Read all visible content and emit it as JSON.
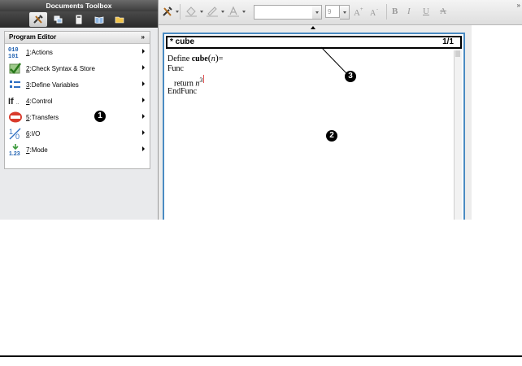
{
  "toolbox": {
    "title": "Documents Toolbox",
    "tabs": [
      {
        "icon": "tools-icon",
        "active": true
      },
      {
        "icon": "page-sorter-icon",
        "active": false
      },
      {
        "icon": "utilities-icon",
        "active": false
      },
      {
        "icon": "content-explorer-icon",
        "active": false
      },
      {
        "icon": "folder-icon",
        "active": false
      }
    ]
  },
  "program_editor": {
    "header": "Program Editor",
    "collapse_glyph": "»",
    "items": [
      {
        "number": "1",
        "label": "Actions",
        "icon": "actions-icon"
      },
      {
        "number": "2",
        "label": "Check Syntax & Store",
        "icon": "check-syntax-icon"
      },
      {
        "number": "3",
        "label": "Define Variables",
        "icon": "define-variables-icon"
      },
      {
        "number": "4",
        "label": "Control",
        "icon": "control-icon"
      },
      {
        "number": "5",
        "label": "Transfers",
        "icon": "transfers-icon"
      },
      {
        "number": "6",
        "label": "I/O",
        "icon": "io-icon"
      },
      {
        "number": "7",
        "label": "Mode",
        "icon": "mode-icon"
      }
    ]
  },
  "format_toolbar": {
    "font_value": "",
    "font_size": "9",
    "bold": "B",
    "italic": "I",
    "underline": "U",
    "strike": "A",
    "expand_glyph": "»"
  },
  "editor": {
    "title": "* cube",
    "page": "1/1",
    "define_keyword": "Define ",
    "function_name": "cube",
    "param": "n",
    "func": "Func",
    "return_keyword": "return ",
    "return_var": "n",
    "exponent": "3",
    "end": "EndFunc"
  },
  "callouts": {
    "one": "1",
    "two": "2",
    "three": "3"
  },
  "colors": {
    "editor_border": "#4a8bc2",
    "toolbox_dark": "#2a2a2a",
    "panel_bg": "#e9eaec"
  }
}
